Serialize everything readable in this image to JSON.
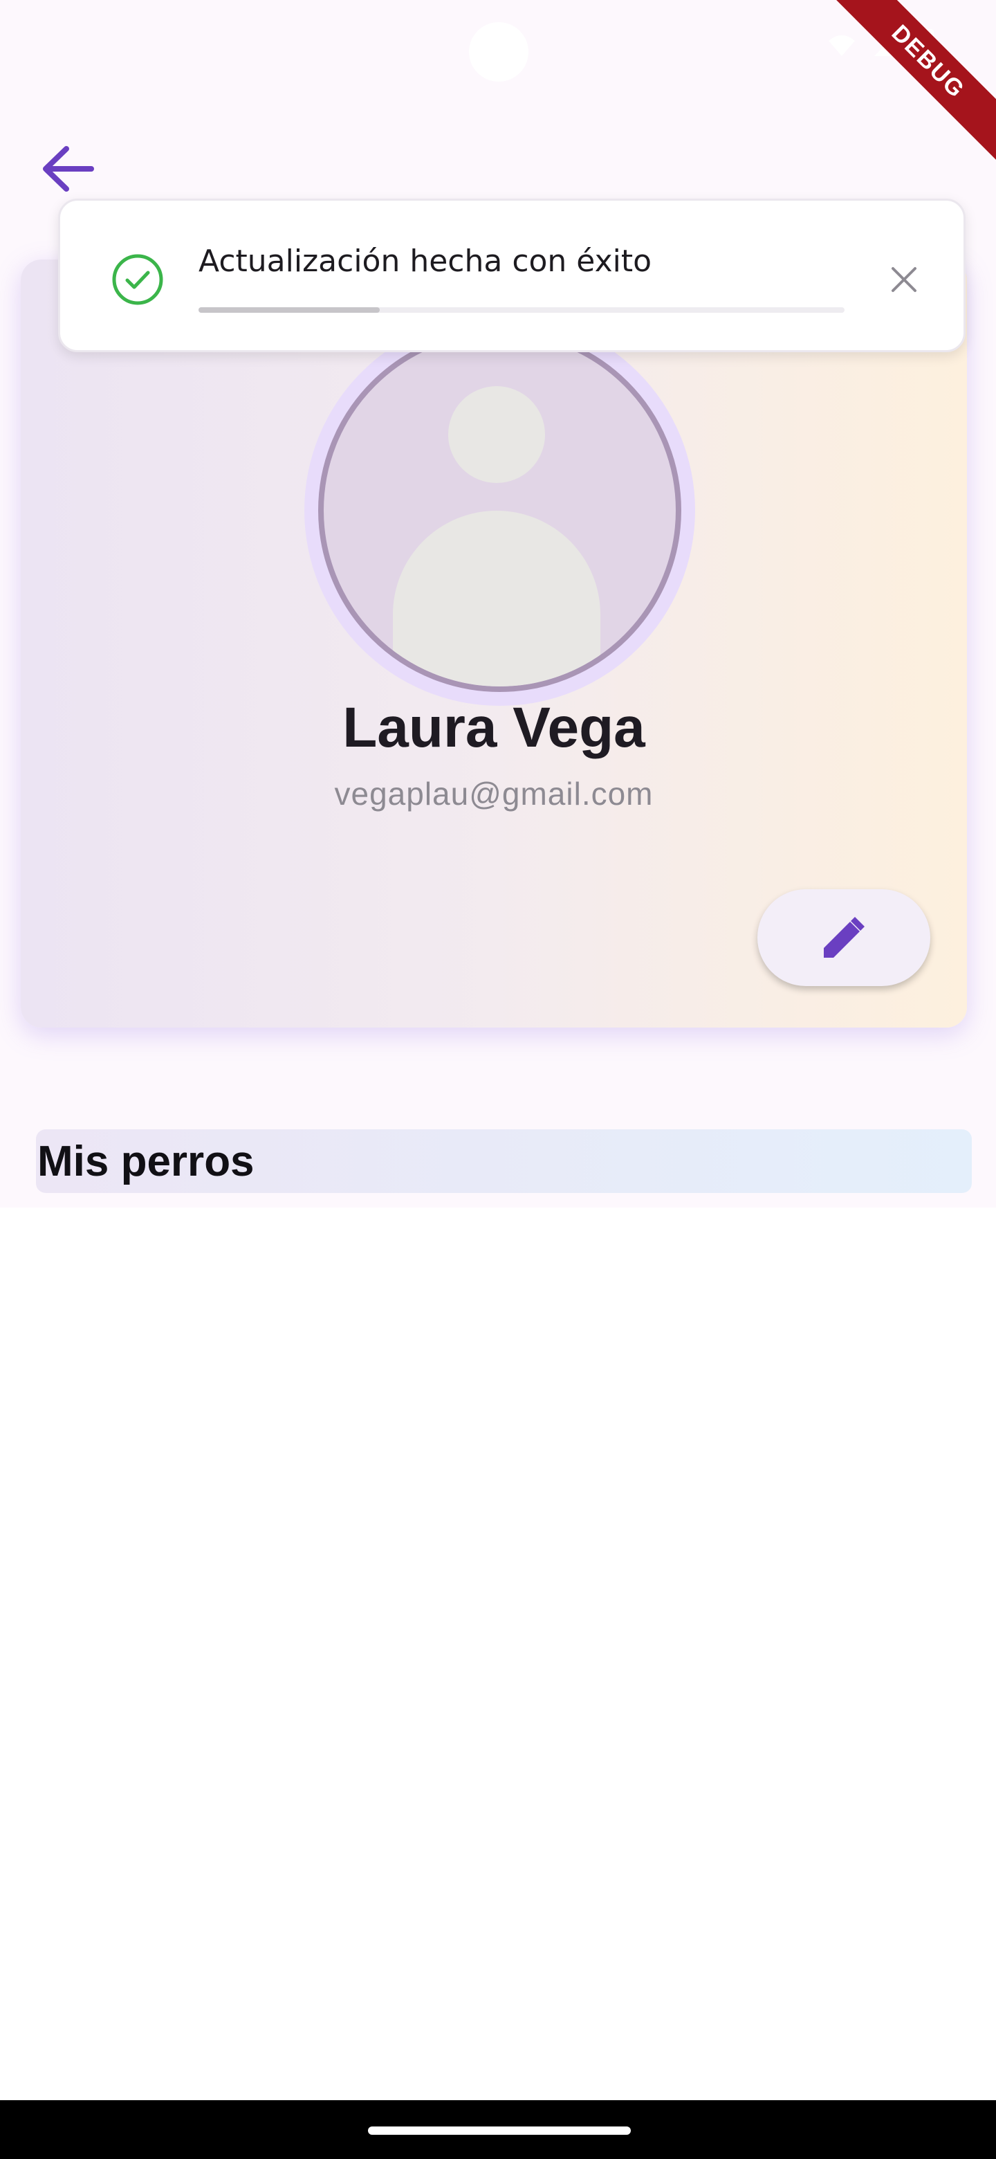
{
  "status_bar": {
    "icons": [
      "wifi-icon",
      "signal-icon",
      "battery-icon"
    ]
  },
  "debug_banner": {
    "label": "DEBUG"
  },
  "header": {
    "back_icon": "arrow-left-icon"
  },
  "profile": {
    "name": "Laura Vega",
    "email": "vegaplau@gmail.com",
    "avatar_icon": "person-placeholder-icon",
    "edit_icon": "pencil-icon"
  },
  "dogs_section": {
    "title": "Mis perros"
  },
  "toast": {
    "message": "Actualización hecha con éxito",
    "status_icon": "check-circle-icon",
    "close_icon": "close-icon",
    "progress": 0.28
  },
  "colors": {
    "accent": "#6a3fc1",
    "success": "#3bb54a",
    "debug": "#a5141c"
  }
}
